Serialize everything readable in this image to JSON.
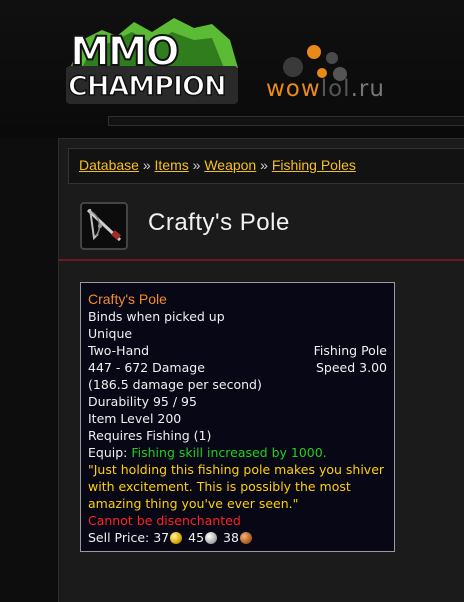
{
  "header": {
    "mmo_logo_line1": "MMO",
    "mmo_logo_line2": "CHAMPION",
    "wow_logo_part1": "wow",
    "wow_logo_part2": "lol",
    "wow_logo_part3": ".ru"
  },
  "breadcrumb": {
    "items": [
      "Database",
      "Items",
      "Weapon",
      "Fishing Poles"
    ],
    "separator": "»"
  },
  "item": {
    "title": "Crafty's Pole",
    "icon": "fishing-pole-icon"
  },
  "tooltip": {
    "name": "Crafty's Pole",
    "binds": "Binds when picked up",
    "unique": "Unique",
    "slot": "Two-Hand",
    "type": "Fishing Pole",
    "damage": "447 - 672 Damage",
    "speed": "Speed 3.00",
    "dps": "(186.5 damage per second)",
    "durability": "Durability 95 / 95",
    "item_level": "Item Level 200",
    "requires": "Requires Fishing (1)",
    "equip_label": "Equip:",
    "equip_text": "Fishing skill increased by 1000.",
    "flavor": "\"Just holding this fishing pole makes you shiver with excitement. This is possibly the most amazing thing you've ever seen.\"",
    "disenchant": "Cannot be disenchanted",
    "sell_label": "Sell Price:",
    "gold": "37",
    "silver": "45",
    "copper": "38"
  },
  "colors": {
    "link": "#f4c021",
    "item_name": "#f28b30",
    "equip": "#1fd11f",
    "flavor": "#ffd100",
    "warning": "#ff2222",
    "divider": "#6b1a22"
  }
}
